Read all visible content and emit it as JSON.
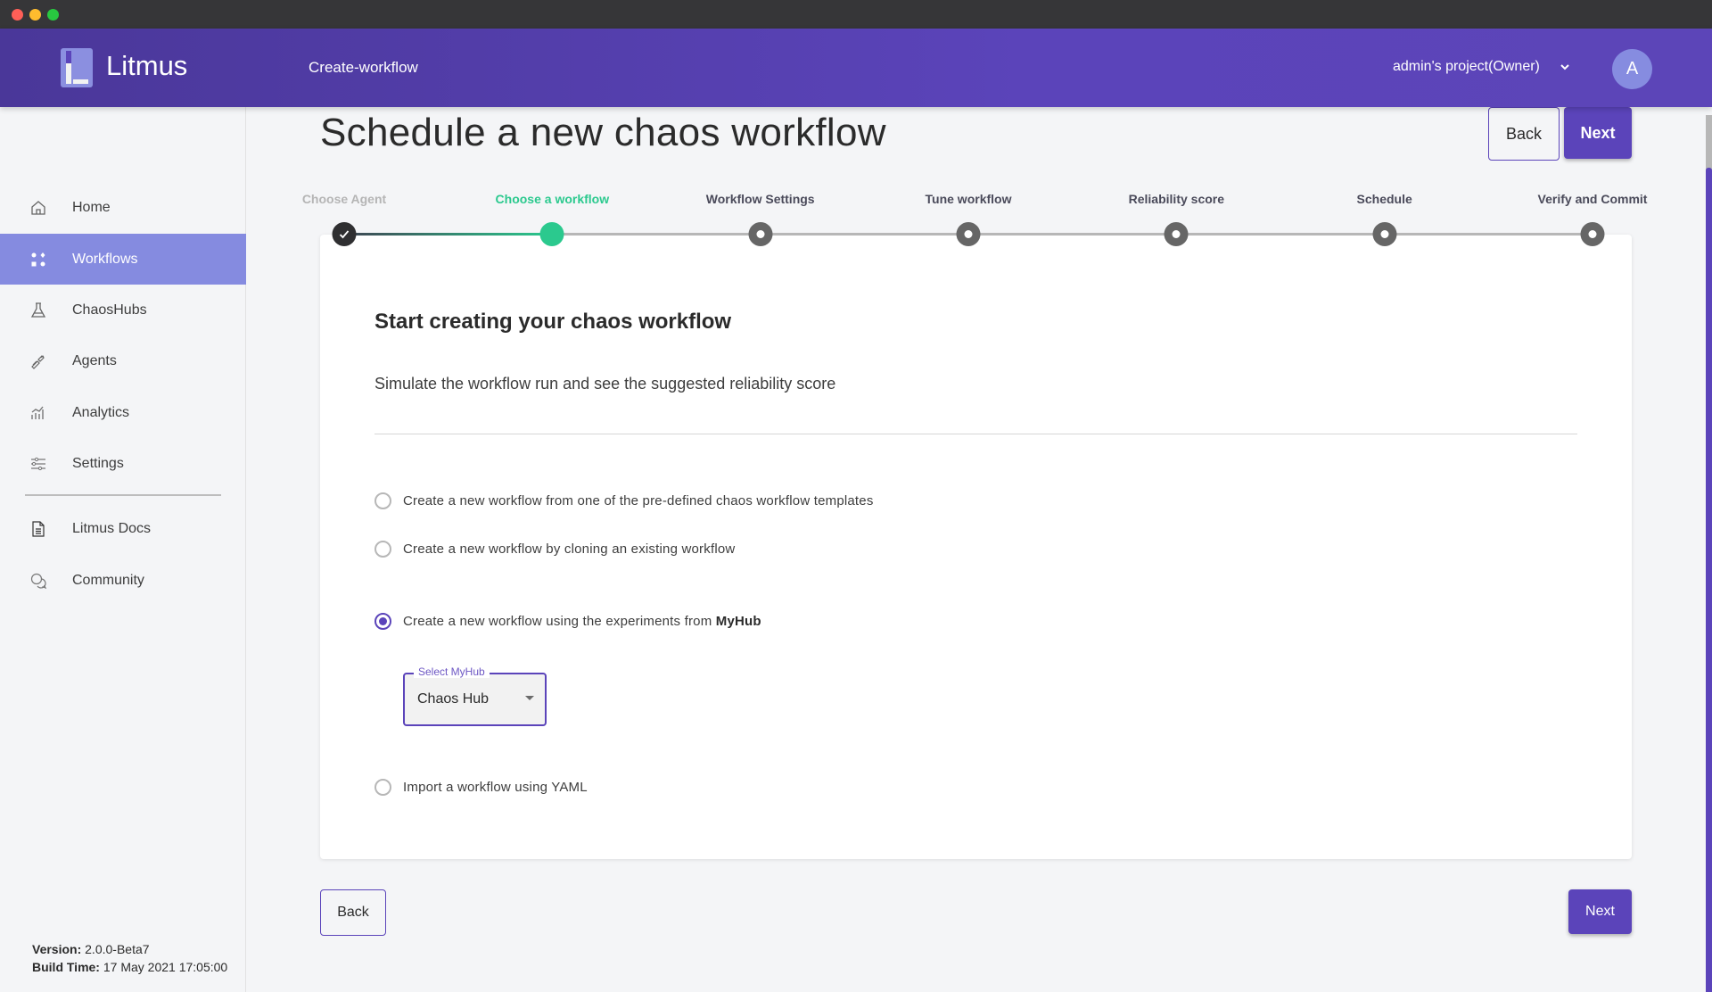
{
  "window": {
    "controls": [
      "close",
      "minimize",
      "maximize"
    ]
  },
  "header": {
    "brand": "Litmus",
    "breadcrumb": "Create-workflow",
    "project": "admin's project(Owner)",
    "avatar_initial": "A",
    "colors": {
      "primary": "#5b44ba",
      "accent_green": "#2bc98e",
      "active_nav": "#858be0"
    }
  },
  "sidebar": {
    "items": [
      {
        "label": "Home",
        "icon": "home-icon",
        "active": false
      },
      {
        "label": "Workflows",
        "icon": "workflows-icon",
        "active": true
      },
      {
        "label": "ChaosHubs",
        "icon": "flask-icon",
        "active": false
      },
      {
        "label": "Agents",
        "icon": "link-icon",
        "active": false
      },
      {
        "label": "Analytics",
        "icon": "analytics-icon",
        "active": false
      },
      {
        "label": "Settings",
        "icon": "sliders-icon",
        "active": false
      }
    ],
    "links": [
      {
        "label": "Litmus Docs",
        "icon": "document-icon"
      },
      {
        "label": "Community",
        "icon": "chat-icon"
      }
    ],
    "version_label": "Version:",
    "version_value": "2.0.0-Beta7",
    "build_label": "Build Time:",
    "build_value": "17 May 2021 17:05:00"
  },
  "main": {
    "title": "Schedule a new chaos workflow",
    "back_label": "Back",
    "next_label": "Next",
    "steps": [
      {
        "label": "Choose Agent",
        "state": "done"
      },
      {
        "label": "Choose a workflow",
        "state": "active"
      },
      {
        "label": "Workflow Settings",
        "state": "pending"
      },
      {
        "label": "Tune workflow",
        "state": "pending"
      },
      {
        "label": "Reliability score",
        "state": "pending"
      },
      {
        "label": "Schedule",
        "state": "pending"
      },
      {
        "label": "Verify and Commit",
        "state": "pending"
      }
    ],
    "card": {
      "title": "Start creating your chaos workflow",
      "subtitle": "Simulate the workflow run and see the suggested reliability score",
      "options": [
        {
          "label": "Create a new workflow from one of the pre-defined chaos workflow templates",
          "checked": false
        },
        {
          "label": "Create a new workflow by cloning an existing workflow",
          "checked": false
        },
        {
          "label": "Create a new workflow using the experiments from ",
          "bold_suffix": "MyHub",
          "checked": true
        },
        {
          "label": "Import a workflow using YAML",
          "checked": false
        }
      ],
      "hub_select": {
        "legend": "Select MyHub",
        "value": "Chaos Hub"
      }
    }
  }
}
